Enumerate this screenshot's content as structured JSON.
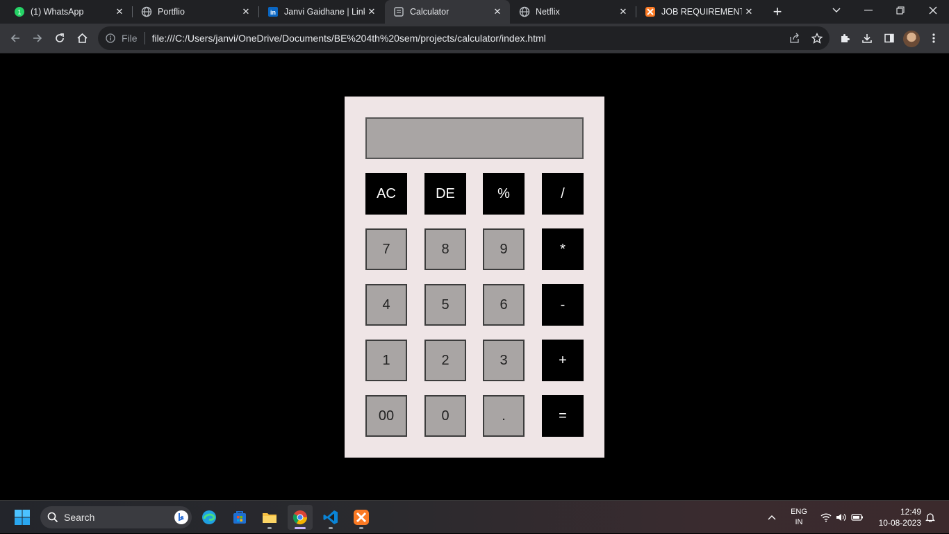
{
  "browser": {
    "tabs": [
      {
        "title": "(1) WhatsApp",
        "icon": "whatsapp-icon",
        "active": false
      },
      {
        "title": "Portflio",
        "icon": "globe-icon",
        "active": false
      },
      {
        "title": "Janvi Gaidhane | LinkedIn",
        "icon": "linkedin-icon",
        "active": false
      },
      {
        "title": "Calculator",
        "icon": "page-icon",
        "active": true
      },
      {
        "title": "Netflix",
        "icon": "globe-icon",
        "active": false
      },
      {
        "title": "JOB REQUIREMENT SYSTEM",
        "icon": "xampp-icon",
        "active": false
      }
    ],
    "address_bar": {
      "scheme_label": "File",
      "url": "file:///C:/Users/janvi/OneDrive/Documents/BE%204th%20sem/projects/calculator/index.html"
    }
  },
  "calculator": {
    "display_value": "",
    "keys": [
      [
        "AC",
        "DE",
        "%",
        "/"
      ],
      [
        "7",
        "8",
        "9",
        "*"
      ],
      [
        "4",
        "5",
        "6",
        "-"
      ],
      [
        "1",
        "2",
        "3",
        "+"
      ],
      [
        "00",
        "0",
        ".",
        "="
      ]
    ],
    "colors": {
      "body": "#efe5e6",
      "display": "#a9a5a4",
      "operator_key": "#000000",
      "digit_key": "#a9a5a4",
      "page_bg": "#000000"
    }
  },
  "taskbar": {
    "search_label": "Search",
    "language": {
      "line1": "ENG",
      "line2": "IN"
    },
    "clock": {
      "time": "12:49",
      "date": "10-08-2023"
    }
  }
}
